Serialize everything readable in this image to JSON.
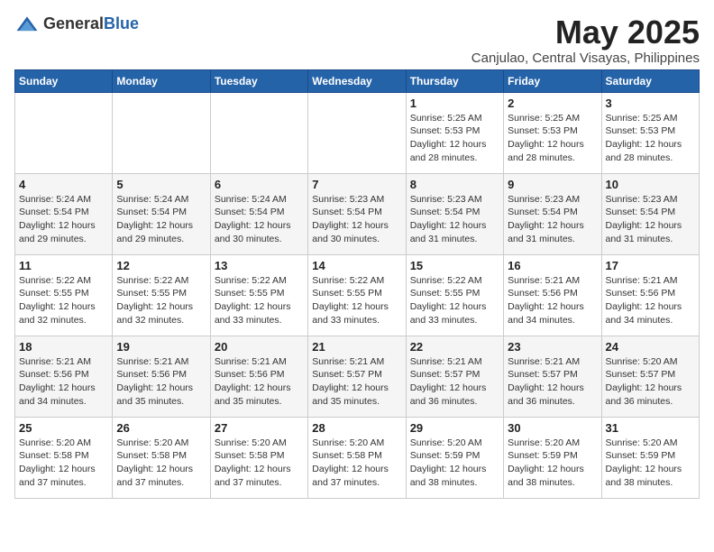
{
  "logo": {
    "text_general": "General",
    "text_blue": "Blue"
  },
  "title": "May 2025",
  "subtitle": "Canjulao, Central Visayas, Philippines",
  "days_of_week": [
    "Sunday",
    "Monday",
    "Tuesday",
    "Wednesday",
    "Thursday",
    "Friday",
    "Saturday"
  ],
  "weeks": [
    [
      {
        "day": "",
        "info": ""
      },
      {
        "day": "",
        "info": ""
      },
      {
        "day": "",
        "info": ""
      },
      {
        "day": "",
        "info": ""
      },
      {
        "day": "1",
        "info": "Sunrise: 5:25 AM\nSunset: 5:53 PM\nDaylight: 12 hours\nand 28 minutes."
      },
      {
        "day": "2",
        "info": "Sunrise: 5:25 AM\nSunset: 5:53 PM\nDaylight: 12 hours\nand 28 minutes."
      },
      {
        "day": "3",
        "info": "Sunrise: 5:25 AM\nSunset: 5:53 PM\nDaylight: 12 hours\nand 28 minutes."
      }
    ],
    [
      {
        "day": "4",
        "info": "Sunrise: 5:24 AM\nSunset: 5:54 PM\nDaylight: 12 hours\nand 29 minutes."
      },
      {
        "day": "5",
        "info": "Sunrise: 5:24 AM\nSunset: 5:54 PM\nDaylight: 12 hours\nand 29 minutes."
      },
      {
        "day": "6",
        "info": "Sunrise: 5:24 AM\nSunset: 5:54 PM\nDaylight: 12 hours\nand 30 minutes."
      },
      {
        "day": "7",
        "info": "Sunrise: 5:23 AM\nSunset: 5:54 PM\nDaylight: 12 hours\nand 30 minutes."
      },
      {
        "day": "8",
        "info": "Sunrise: 5:23 AM\nSunset: 5:54 PM\nDaylight: 12 hours\nand 31 minutes."
      },
      {
        "day": "9",
        "info": "Sunrise: 5:23 AM\nSunset: 5:54 PM\nDaylight: 12 hours\nand 31 minutes."
      },
      {
        "day": "10",
        "info": "Sunrise: 5:23 AM\nSunset: 5:54 PM\nDaylight: 12 hours\nand 31 minutes."
      }
    ],
    [
      {
        "day": "11",
        "info": "Sunrise: 5:22 AM\nSunset: 5:55 PM\nDaylight: 12 hours\nand 32 minutes."
      },
      {
        "day": "12",
        "info": "Sunrise: 5:22 AM\nSunset: 5:55 PM\nDaylight: 12 hours\nand 32 minutes."
      },
      {
        "day": "13",
        "info": "Sunrise: 5:22 AM\nSunset: 5:55 PM\nDaylight: 12 hours\nand 33 minutes."
      },
      {
        "day": "14",
        "info": "Sunrise: 5:22 AM\nSunset: 5:55 PM\nDaylight: 12 hours\nand 33 minutes."
      },
      {
        "day": "15",
        "info": "Sunrise: 5:22 AM\nSunset: 5:55 PM\nDaylight: 12 hours\nand 33 minutes."
      },
      {
        "day": "16",
        "info": "Sunrise: 5:21 AM\nSunset: 5:56 PM\nDaylight: 12 hours\nand 34 minutes."
      },
      {
        "day": "17",
        "info": "Sunrise: 5:21 AM\nSunset: 5:56 PM\nDaylight: 12 hours\nand 34 minutes."
      }
    ],
    [
      {
        "day": "18",
        "info": "Sunrise: 5:21 AM\nSunset: 5:56 PM\nDaylight: 12 hours\nand 34 minutes."
      },
      {
        "day": "19",
        "info": "Sunrise: 5:21 AM\nSunset: 5:56 PM\nDaylight: 12 hours\nand 35 minutes."
      },
      {
        "day": "20",
        "info": "Sunrise: 5:21 AM\nSunset: 5:56 PM\nDaylight: 12 hours\nand 35 minutes."
      },
      {
        "day": "21",
        "info": "Sunrise: 5:21 AM\nSunset: 5:57 PM\nDaylight: 12 hours\nand 35 minutes."
      },
      {
        "day": "22",
        "info": "Sunrise: 5:21 AM\nSunset: 5:57 PM\nDaylight: 12 hours\nand 36 minutes."
      },
      {
        "day": "23",
        "info": "Sunrise: 5:21 AM\nSunset: 5:57 PM\nDaylight: 12 hours\nand 36 minutes."
      },
      {
        "day": "24",
        "info": "Sunrise: 5:20 AM\nSunset: 5:57 PM\nDaylight: 12 hours\nand 36 minutes."
      }
    ],
    [
      {
        "day": "25",
        "info": "Sunrise: 5:20 AM\nSunset: 5:58 PM\nDaylight: 12 hours\nand 37 minutes."
      },
      {
        "day": "26",
        "info": "Sunrise: 5:20 AM\nSunset: 5:58 PM\nDaylight: 12 hours\nand 37 minutes."
      },
      {
        "day": "27",
        "info": "Sunrise: 5:20 AM\nSunset: 5:58 PM\nDaylight: 12 hours\nand 37 minutes."
      },
      {
        "day": "28",
        "info": "Sunrise: 5:20 AM\nSunset: 5:58 PM\nDaylight: 12 hours\nand 37 minutes."
      },
      {
        "day": "29",
        "info": "Sunrise: 5:20 AM\nSunset: 5:59 PM\nDaylight: 12 hours\nand 38 minutes."
      },
      {
        "day": "30",
        "info": "Sunrise: 5:20 AM\nSunset: 5:59 PM\nDaylight: 12 hours\nand 38 minutes."
      },
      {
        "day": "31",
        "info": "Sunrise: 5:20 AM\nSunset: 5:59 PM\nDaylight: 12 hours\nand 38 minutes."
      }
    ]
  ]
}
